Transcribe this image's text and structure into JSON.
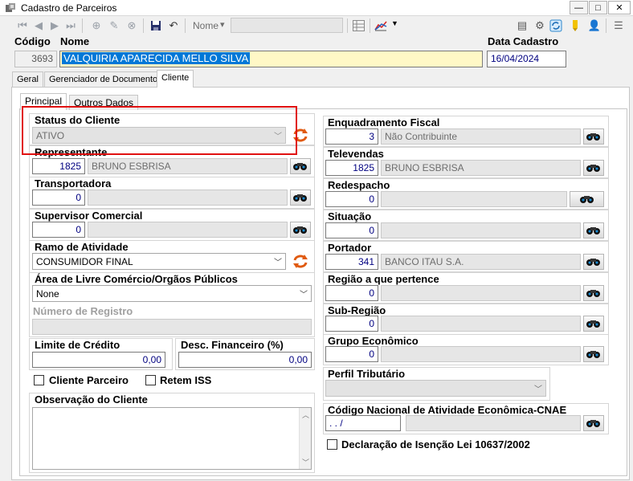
{
  "window": {
    "title": "Cadastro de Parceiros",
    "minimize": "—",
    "maximize": "□",
    "close": "✕"
  },
  "toolbar": {
    "search_field_label": "Nome",
    "search_dropdown_arrow": "▾",
    "search_value": ""
  },
  "header": {
    "codigo_label": "Código",
    "codigo_value": "3693",
    "nome_label": "Nome",
    "nome_value": "VALQUIRIA APARECIDA MELLO SILVA",
    "data_cadastro_label": "Data Cadastro",
    "data_cadastro_value": "16/04/2024"
  },
  "tabs": [
    {
      "label": "Geral",
      "active": false
    },
    {
      "label": "Gerenciador de Documentos",
      "active": false
    },
    {
      "label": "Cliente",
      "active": true
    }
  ],
  "inner_tabs": [
    {
      "label": "Principal",
      "active": true
    },
    {
      "label": "Outros Dados",
      "active": false
    }
  ],
  "left": {
    "status_label": "Status do Cliente",
    "status_value": "ATIVO",
    "representante_label": "Representante",
    "representante_code": "1825",
    "representante_name": "BRUNO ESBRISA",
    "transportadora_label": "Transportadora",
    "transportadora_code": "0",
    "transportadora_name": "",
    "supervisor_label": "Supervisor Comercial",
    "supervisor_code": "0",
    "supervisor_name": "",
    "ramo_label": "Ramo de Atividade",
    "ramo_value": "CONSUMIDOR FINAL",
    "area_label": "Área de Livre Comércio/Orgãos Públicos",
    "area_value": "None",
    "numero_registro_label": "Número de Registro",
    "numero_registro_value": "",
    "limite_label": "Limite de Crédito",
    "limite_value": "0,00",
    "desc_label": "Desc. Financeiro (%)",
    "desc_value": "0,00",
    "cliente_parceiro_label": "Cliente Parceiro",
    "retem_iss_label": "Retem ISS",
    "observacao_label": "Observação do Cliente",
    "observacao_value": ""
  },
  "right": {
    "enquadramento_label": "Enquadramento Fiscal",
    "enquadramento_code": "3",
    "enquadramento_name": "Não Contribuinte",
    "televendas_label": "Televendas",
    "televendas_code": "1825",
    "televendas_name": "BRUNO ESBRISA",
    "redespacho_label": "Redespacho",
    "redespacho_code": "0",
    "redespacho_name": "",
    "situacao_label": "Situação",
    "situacao_code": "0",
    "situacao_name": "",
    "portador_label": "Portador",
    "portador_code": "341",
    "portador_name": "BANCO ITAU S.A.",
    "regiao_label": "Região a que pertence",
    "regiao_code": "0",
    "regiao_name": "",
    "subregiao_label": "Sub-Região",
    "subregiao_code": "0",
    "subregiao_name": "",
    "grupo_label": "Grupo Econômico",
    "grupo_code": "0",
    "grupo_name": "",
    "perfil_label": "Perfil Tributário",
    "perfil_value": "",
    "cnae_label": "Código Nacional de Atividade Econômica-CNAE",
    "cnae_value": ". . /",
    "cnae_desc": "",
    "declaracao_label": "Declaração de Isenção Lei 10637/2002"
  },
  "colors": {
    "highlight": "#e01010",
    "name_bg": "#fff8c6",
    "selection": "#0078d7"
  }
}
